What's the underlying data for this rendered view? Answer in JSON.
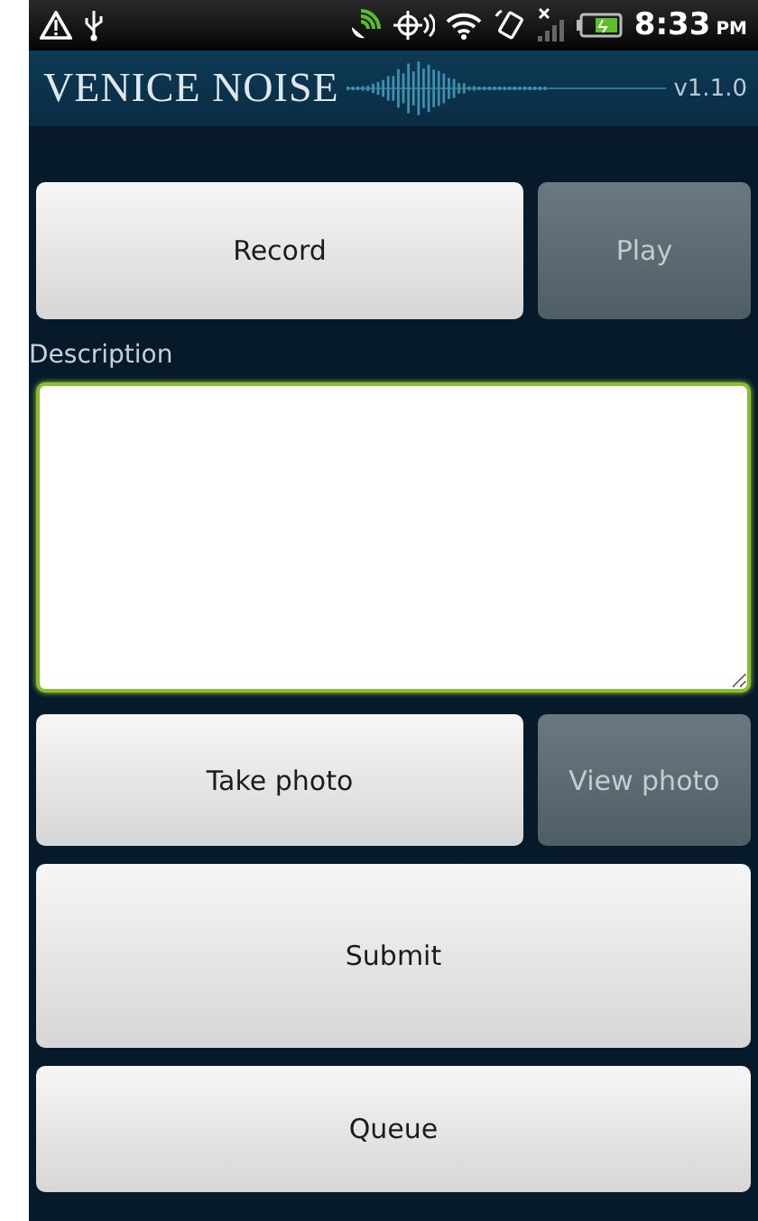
{
  "status_bar": {
    "time": "8:33",
    "ampm": "PM"
  },
  "header": {
    "title": "VENICE NOISE",
    "version": "v1.1.0"
  },
  "audio_buttons": [
    {
      "label": "Record",
      "disabled": false,
      "wide": true
    },
    {
      "label": "Play",
      "disabled": true,
      "wide": false
    }
  ],
  "description": {
    "label": "Description",
    "focused": true
  },
  "photo_buttons": [
    {
      "label": "Take photo",
      "disabled": false,
      "wide": true
    },
    {
      "label": "View photo",
      "disabled": true,
      "wide": false
    }
  ],
  "actions": [
    {
      "label": "Submit",
      "disabled": false
    },
    {
      "label": "Queue",
      "disabled": false
    }
  ]
}
